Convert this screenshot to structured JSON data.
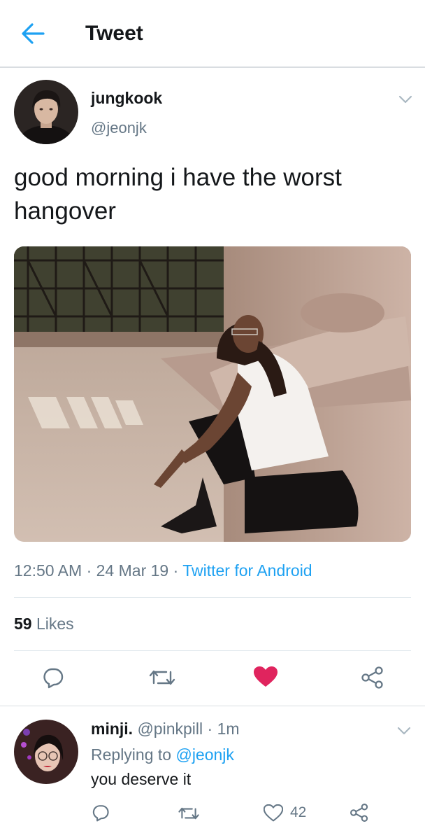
{
  "header": {
    "title": "Tweet",
    "back_icon": "arrow-left-icon",
    "accent": "#1da1f2"
  },
  "tweet": {
    "author_name": "jungkook",
    "author_handle": "@jeonjk",
    "text": "good morning i have the worst hangover",
    "time": "12:50 AM",
    "date": "24 Mar 19",
    "source": "Twitter for Android",
    "likes_count": "59",
    "likes_label": "Likes",
    "liked": true,
    "like_color": "#e0245e"
  },
  "actions": [
    "reply-icon",
    "retweet-icon",
    "heart-icon",
    "share-icon"
  ],
  "reply": {
    "name": "minji.",
    "handle": "@pinkpill",
    "time": "1m",
    "replying_to_label": "Replying to",
    "replying_to_handle": "@jeonjk",
    "text": "you deserve it",
    "like_count": "42"
  }
}
